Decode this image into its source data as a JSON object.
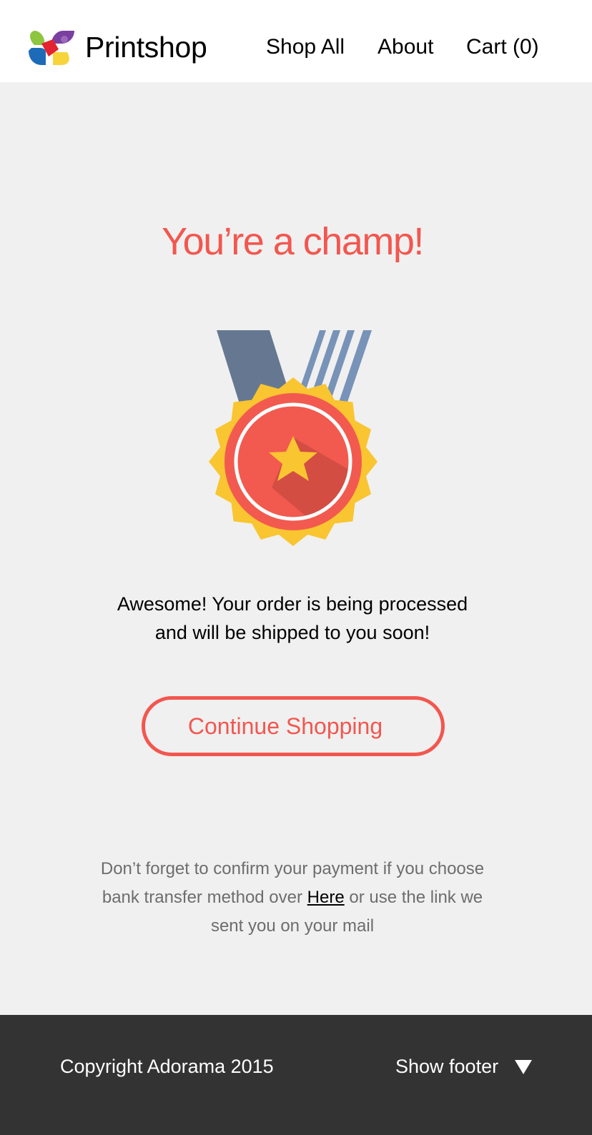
{
  "header": {
    "brand": "Printshop",
    "nav": {
      "shop_all": "Shop All",
      "about": "About",
      "cart": "Cart (0)"
    }
  },
  "main": {
    "headline": "You’re a champ!",
    "message_line1": "Awesome! Your order is being processed",
    "message_line2": "and will be shipped to you soon!",
    "continue_label": "Continue Shopping",
    "note_line1": "Don’t forget to confirm your payment if you choose",
    "note_line2_prefix": "bank transfer method over ",
    "note_link": "Here",
    "note_line2_suffix": " or use the link we",
    "note_line3": "sent you on your mail"
  },
  "footer": {
    "copyright": "Copyright Adorama 2015",
    "show_footer": "Show footer"
  },
  "icons": {
    "logo": "printshop-logo-icon",
    "medal": "medal-icon",
    "caret": "caret-down-icon"
  },
  "colors": {
    "accent": "#f2574f",
    "background": "#f0f0f0",
    "header_bg": "#ffffff",
    "footer_bg": "#333333",
    "medal_gold": "#f9c531",
    "ribbon_dark": "#667891",
    "ribbon_light": "#7893b8"
  }
}
